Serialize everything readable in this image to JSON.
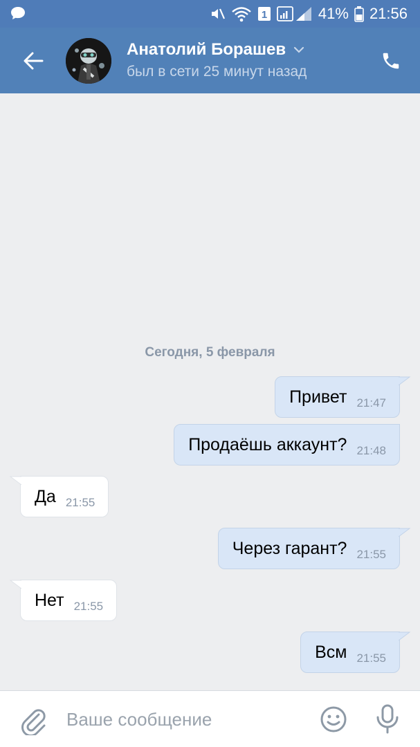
{
  "status_bar": {
    "notification_icon": "chat-bubble-icon",
    "silent_icon": "mute-icon",
    "wifi_icon": "wifi-icon",
    "sim_badge": "1",
    "signal_icon": "signal-icon",
    "battery_percent": "41%",
    "battery_icon": "battery-icon",
    "time": "21:56"
  },
  "header": {
    "back_icon": "arrow-left-icon",
    "contact_name": "Анатолий Борашев",
    "status": "был в сети 25 минут назад",
    "dropdown_icon": "chevron-down-icon",
    "call_icon": "phone-icon",
    "accent_color": "#5181b8"
  },
  "chat": {
    "date_separator": "Сегодня, 5 февраля",
    "messages": [
      {
        "direction": "out",
        "text": "Привет",
        "time": "21:47"
      },
      {
        "direction": "out",
        "text": "Продаёшь аккаунт?",
        "time": "21:48"
      },
      {
        "direction": "in",
        "text": "Да",
        "time": "21:55"
      },
      {
        "direction": "out",
        "text": "Через гарант?",
        "time": "21:55"
      },
      {
        "direction": "in",
        "text": "Нет",
        "time": "21:55"
      },
      {
        "direction": "out",
        "text": "Всм",
        "time": "21:55"
      }
    ]
  },
  "composer": {
    "attach_icon": "paperclip-icon",
    "placeholder": "Ваше сообщение",
    "emoji_icon": "smiley-icon",
    "mic_icon": "microphone-icon"
  }
}
